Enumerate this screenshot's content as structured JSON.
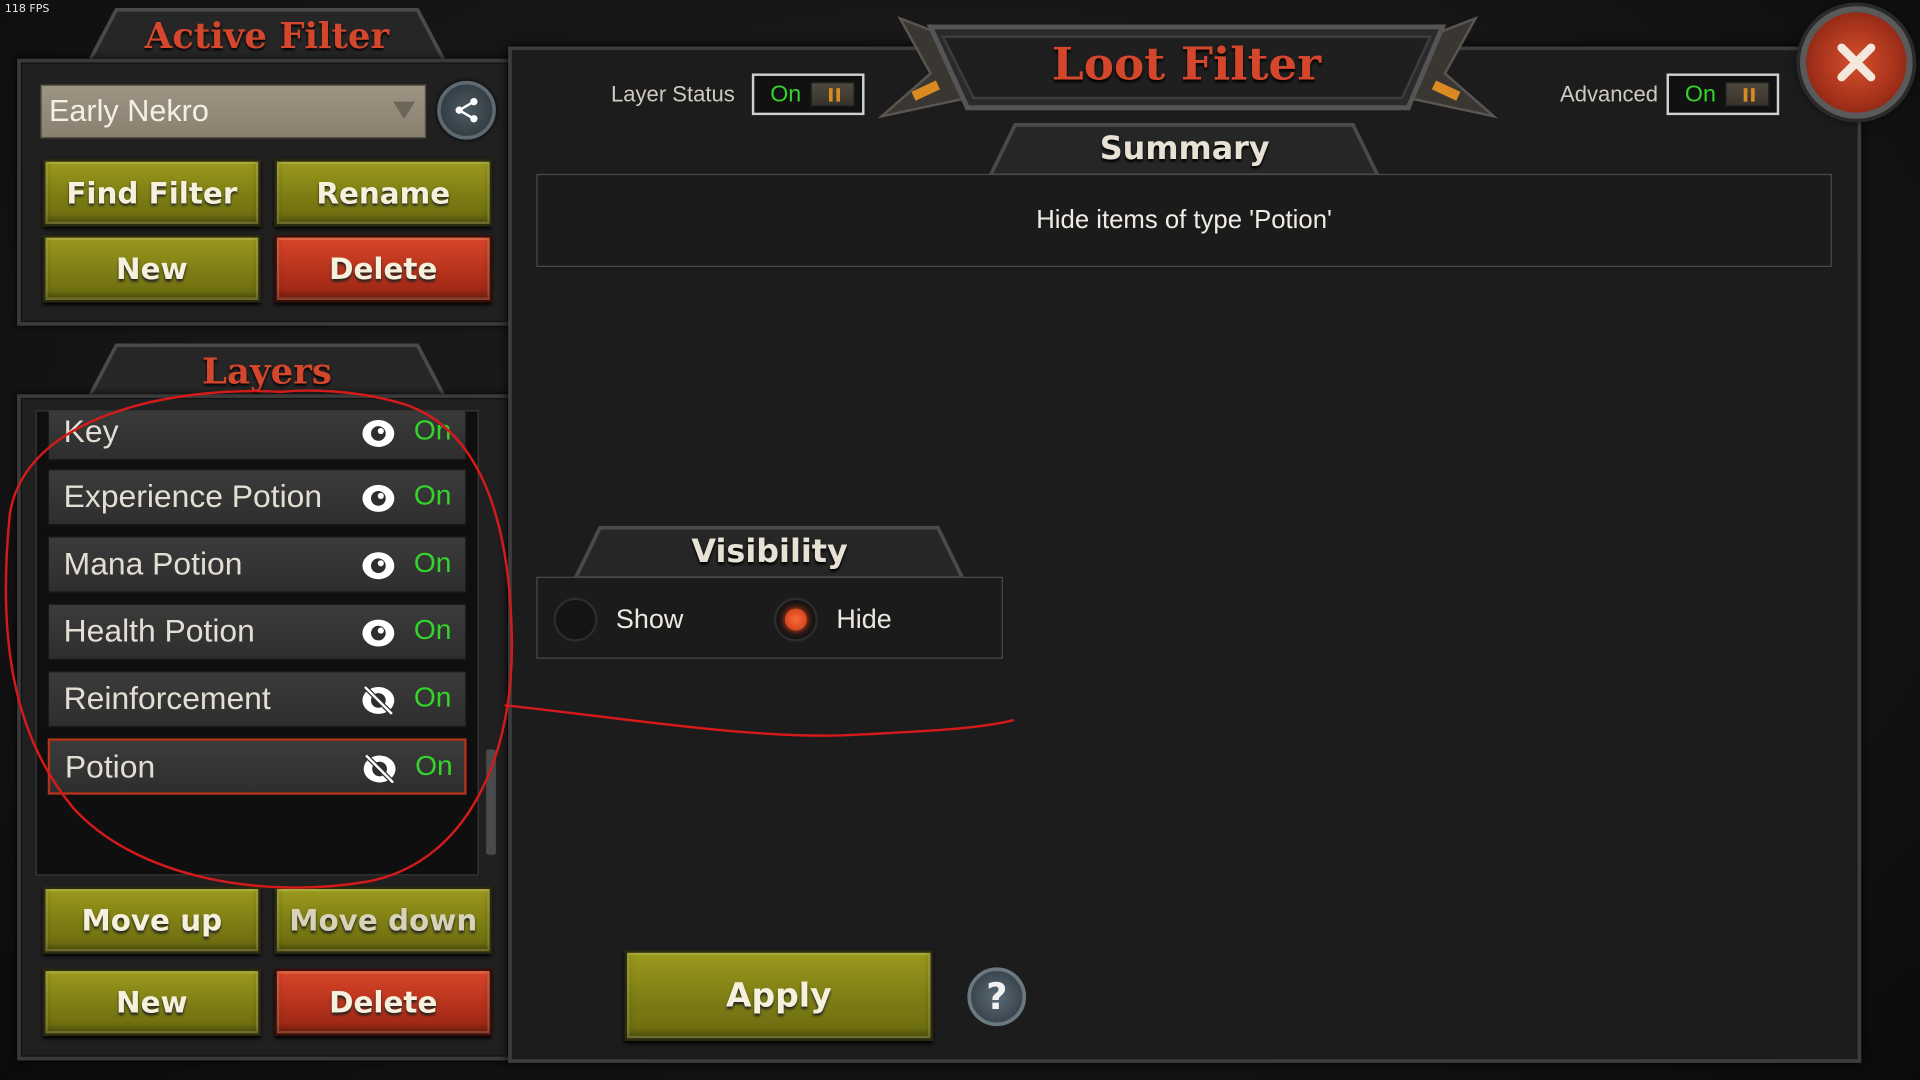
{
  "fps": "118 FPS",
  "active_filter": {
    "title": "Active Filter",
    "selected_filter": "Early Nekro",
    "buttons": {
      "find_filter": "Find Filter",
      "rename": "Rename",
      "new": "New",
      "delete": "Delete"
    }
  },
  "layers": {
    "title": "Layers",
    "items": [
      {
        "label": "Key",
        "visible": true,
        "status": "On",
        "selected": false
      },
      {
        "label": "Experience Potion",
        "visible": true,
        "status": "On",
        "selected": false
      },
      {
        "label": "Mana Potion",
        "visible": true,
        "status": "On",
        "selected": false
      },
      {
        "label": "Health Potion",
        "visible": true,
        "status": "On",
        "selected": false
      },
      {
        "label": "Reinforcement",
        "visible": false,
        "status": "On",
        "selected": false
      },
      {
        "label": "Potion",
        "visible": false,
        "status": "On",
        "selected": true
      }
    ],
    "buttons": {
      "move_up": "Move up",
      "move_down": "Move down",
      "new": "New",
      "delete": "Delete"
    }
  },
  "loot_filter": {
    "title": "Loot Filter",
    "layer_status_label": "Layer Status",
    "layer_status_value": "On",
    "advanced_label": "Advanced",
    "advanced_value": "On",
    "summary_title": "Summary",
    "summary_text": "Hide items of type 'Potion'",
    "visibility_title": "Visibility",
    "visibility_options": {
      "show": "Show",
      "hide": "Hide"
    },
    "visibility_selected": "hide",
    "apply": "Apply",
    "help": "?"
  },
  "colors": {
    "accent_red": "#d4472c",
    "status_green": "#33d42c",
    "button_olive": "#8a8a16",
    "button_red": "#b5321c"
  }
}
